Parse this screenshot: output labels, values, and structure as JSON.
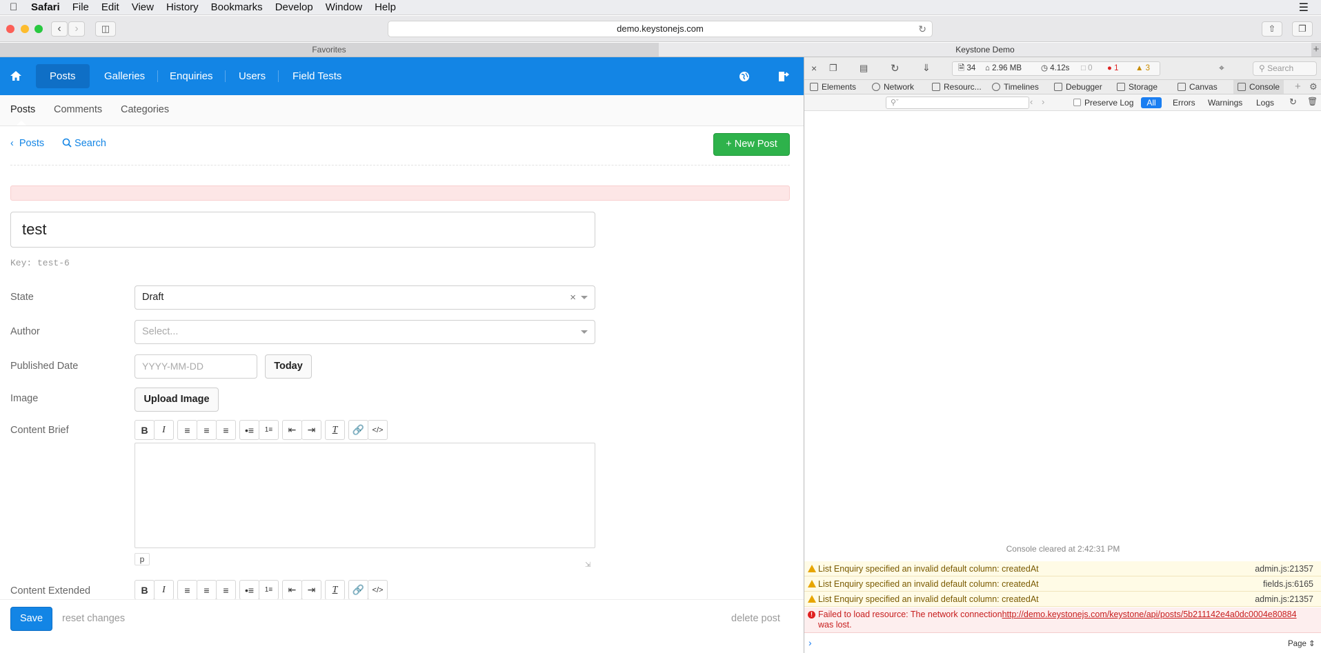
{
  "menubar": {
    "items": [
      "Safari",
      "File",
      "Edit",
      "View",
      "History",
      "Bookmarks",
      "Develop",
      "Window",
      "Help"
    ]
  },
  "browser": {
    "url": "demo.keystonejs.com",
    "tabs": [
      "Favorites",
      "Keystone Demo"
    ]
  },
  "app": {
    "nav": [
      "Posts",
      "Galleries",
      "Enquiries",
      "Users",
      "Field Tests"
    ],
    "subnav": [
      "Posts",
      "Comments",
      "Categories"
    ],
    "back_label": "Posts",
    "search_label": "Search",
    "new_post_label": "New Post",
    "title_value": "test",
    "key_text": "Key: test-6",
    "fields": {
      "state_label": "State",
      "state_value": "Draft",
      "author_label": "Author",
      "author_placeholder": "Select...",
      "published_label": "Published Date",
      "date_placeholder": "YYYY-MM-DD",
      "today_label": "Today",
      "image_label": "Image",
      "upload_label": "Upload Image",
      "content_brief_label": "Content Brief",
      "content_extended_label": "Content Extended",
      "path_tag": "p"
    },
    "footer": {
      "save": "Save",
      "reset": "reset changes",
      "delete": "delete post"
    }
  },
  "devtools": {
    "stats": {
      "resources": "34",
      "size": "2.96 MB",
      "time": "4.12s",
      "messages": "0",
      "errors": "1",
      "warnings": "3"
    },
    "search_placeholder": "Search",
    "tabs": [
      "Elements",
      "Network",
      "Resourc...",
      "Timelines",
      "Debugger",
      "Storage",
      "Canvas",
      "Console"
    ],
    "filter": {
      "preserve_log": "Preserve Log",
      "levels": [
        "All",
        "Errors",
        "Warnings",
        "Logs"
      ]
    },
    "console": {
      "cleared": "Console cleared at 2:42:31 PM",
      "warnings": [
        {
          "text": "List Enquiry specified an invalid default column: createdAt",
          "source": "admin.js:21357"
        },
        {
          "text": "List Enquiry specified an invalid default column: createdAt",
          "source": "fields.js:6165"
        },
        {
          "text": "List Enquiry specified an invalid default column: createdAt",
          "source": "admin.js:21357"
        }
      ],
      "error_prefix": "Failed to load resource: The network connection",
      "error_link": "http://demo.keystonejs.com/keystone/api/posts/5b211142e4a0dc0004e80884",
      "error_suffix": "was lost.",
      "page_label": "Page"
    }
  },
  "colors": {
    "primary": "#1385e5",
    "success": "#2eb24b",
    "danger_bg": "#fde6e6"
  }
}
